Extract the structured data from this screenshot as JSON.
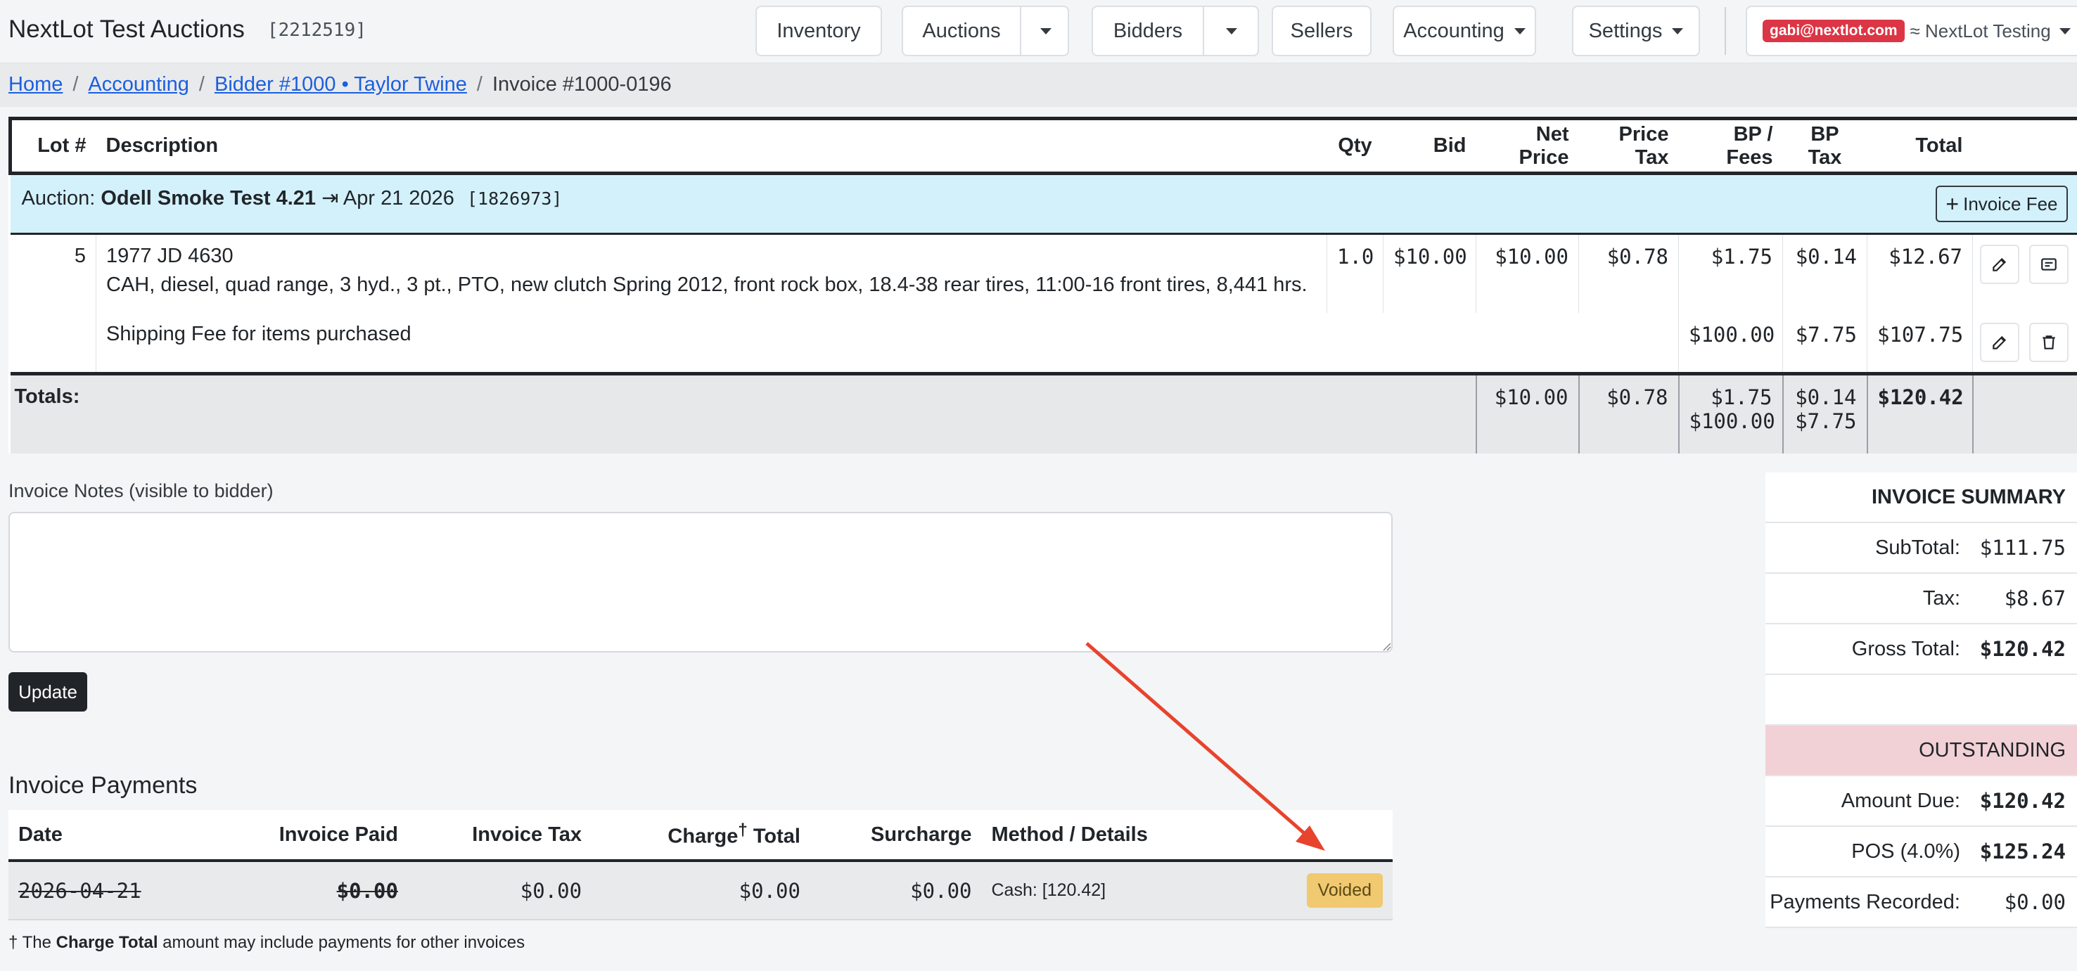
{
  "navbar": {
    "brand": "NextLot Test Auctions",
    "brand_id": "[2212519]",
    "inventory": "Inventory",
    "auctions": "Auctions",
    "bidders": "Bidders",
    "sellers": "Sellers",
    "accounting": "Accounting",
    "settings": "Settings",
    "user_email": "gabi@nextlot.com",
    "org_name": "≈ NextLot Testing"
  },
  "breadcrumb": {
    "home": "Home",
    "accounting": "Accounting",
    "bidder": "Bidder #1000 • Taylor Twine",
    "current": "Invoice #1000-0196"
  },
  "lots_table": {
    "headers": {
      "lot": "Lot #",
      "description": "Description",
      "qty": "Qty",
      "bid": "Bid",
      "net_price": "Net Price",
      "price_tax": "Price Tax",
      "bp_fees": "BP / Fees",
      "bp_tax": "BP Tax",
      "total": "Total"
    },
    "auction": {
      "prefix": "Auction: ",
      "name": "Odell Smoke Test 4.21",
      "date": "⇥ Apr 21 2026",
      "id": "[1826973]",
      "fee_button": "Invoice Fee"
    },
    "item": {
      "lot": "5",
      "title": "1977 JD 4630",
      "details": "CAH, diesel, quad range, 3 hyd., 3 pt., PTO, new clutch Spring 2012, front rock box, 18.4-38 rear tires, 11:00-16 front tires, 8,441 hrs.",
      "qty": "1.0",
      "bid": "$10.00",
      "net_price": "$10.00",
      "price_tax": "$0.78",
      "bp_fees": "$1.75",
      "bp_tax": "$0.14",
      "total": "$12.67"
    },
    "shipping": {
      "description": "Shipping Fee for items purchased",
      "bp_fees": "$100.00",
      "bp_tax": "$7.75",
      "total": "$107.75"
    },
    "totals": {
      "label": "Totals:",
      "net_price": "$10.00",
      "price_tax": "$0.78",
      "bp_fees_1": "$1.75",
      "bp_fees_2": "$100.00",
      "bp_tax_1": "$0.14",
      "bp_tax_2": "$7.75",
      "total": "$120.42"
    }
  },
  "notes": {
    "label": "Invoice Notes (visible to bidder)",
    "value": "",
    "update_button": "Update"
  },
  "payments": {
    "title": "Invoice Payments",
    "headers": {
      "date": "Date",
      "invoice_paid": "Invoice Paid",
      "invoice_tax": "Invoice Tax",
      "charge_total_pre": "Charge",
      "charge_total_dagger": "†",
      "charge_total_post": " Total",
      "surcharge": "Surcharge",
      "method": "Method / Details"
    },
    "rows": [
      {
        "date": "2026-04-21",
        "invoice_paid": "$0.00",
        "invoice_tax": "$0.00",
        "charge_total": "$0.00",
        "surcharge": "$0.00",
        "method": "Cash: [120.42]",
        "status": "Voided"
      }
    ],
    "footnote_pre": "† The ",
    "footnote_bold": "Charge Total",
    "footnote_post": " amount may include payments for other invoices"
  },
  "summary": {
    "title": "INVOICE SUMMARY",
    "subtotal_label": "SubTotal:",
    "subtotal": "$111.75",
    "tax_label": "Tax:",
    "tax": "$8.67",
    "gross_label": "Gross Total:",
    "gross": "$120.42",
    "outstanding_title": "OUTSTANDING",
    "amount_due_label": "Amount Due:",
    "amount_due": "$120.42",
    "pos_label": "POS (4.0%)",
    "pos": "$125.24",
    "payments_recorded_label": "Payments Recorded:",
    "payments_recorded": "$0.00"
  },
  "colors": {
    "accent_link": "#1a5fe0",
    "auction_row_bg": "#d3f1fb",
    "email_badge": "#dc3545",
    "voided_badge": "#f0c970",
    "outstanding_bg": "#f1d1d6",
    "annotation_arrow": "#e8432d"
  }
}
